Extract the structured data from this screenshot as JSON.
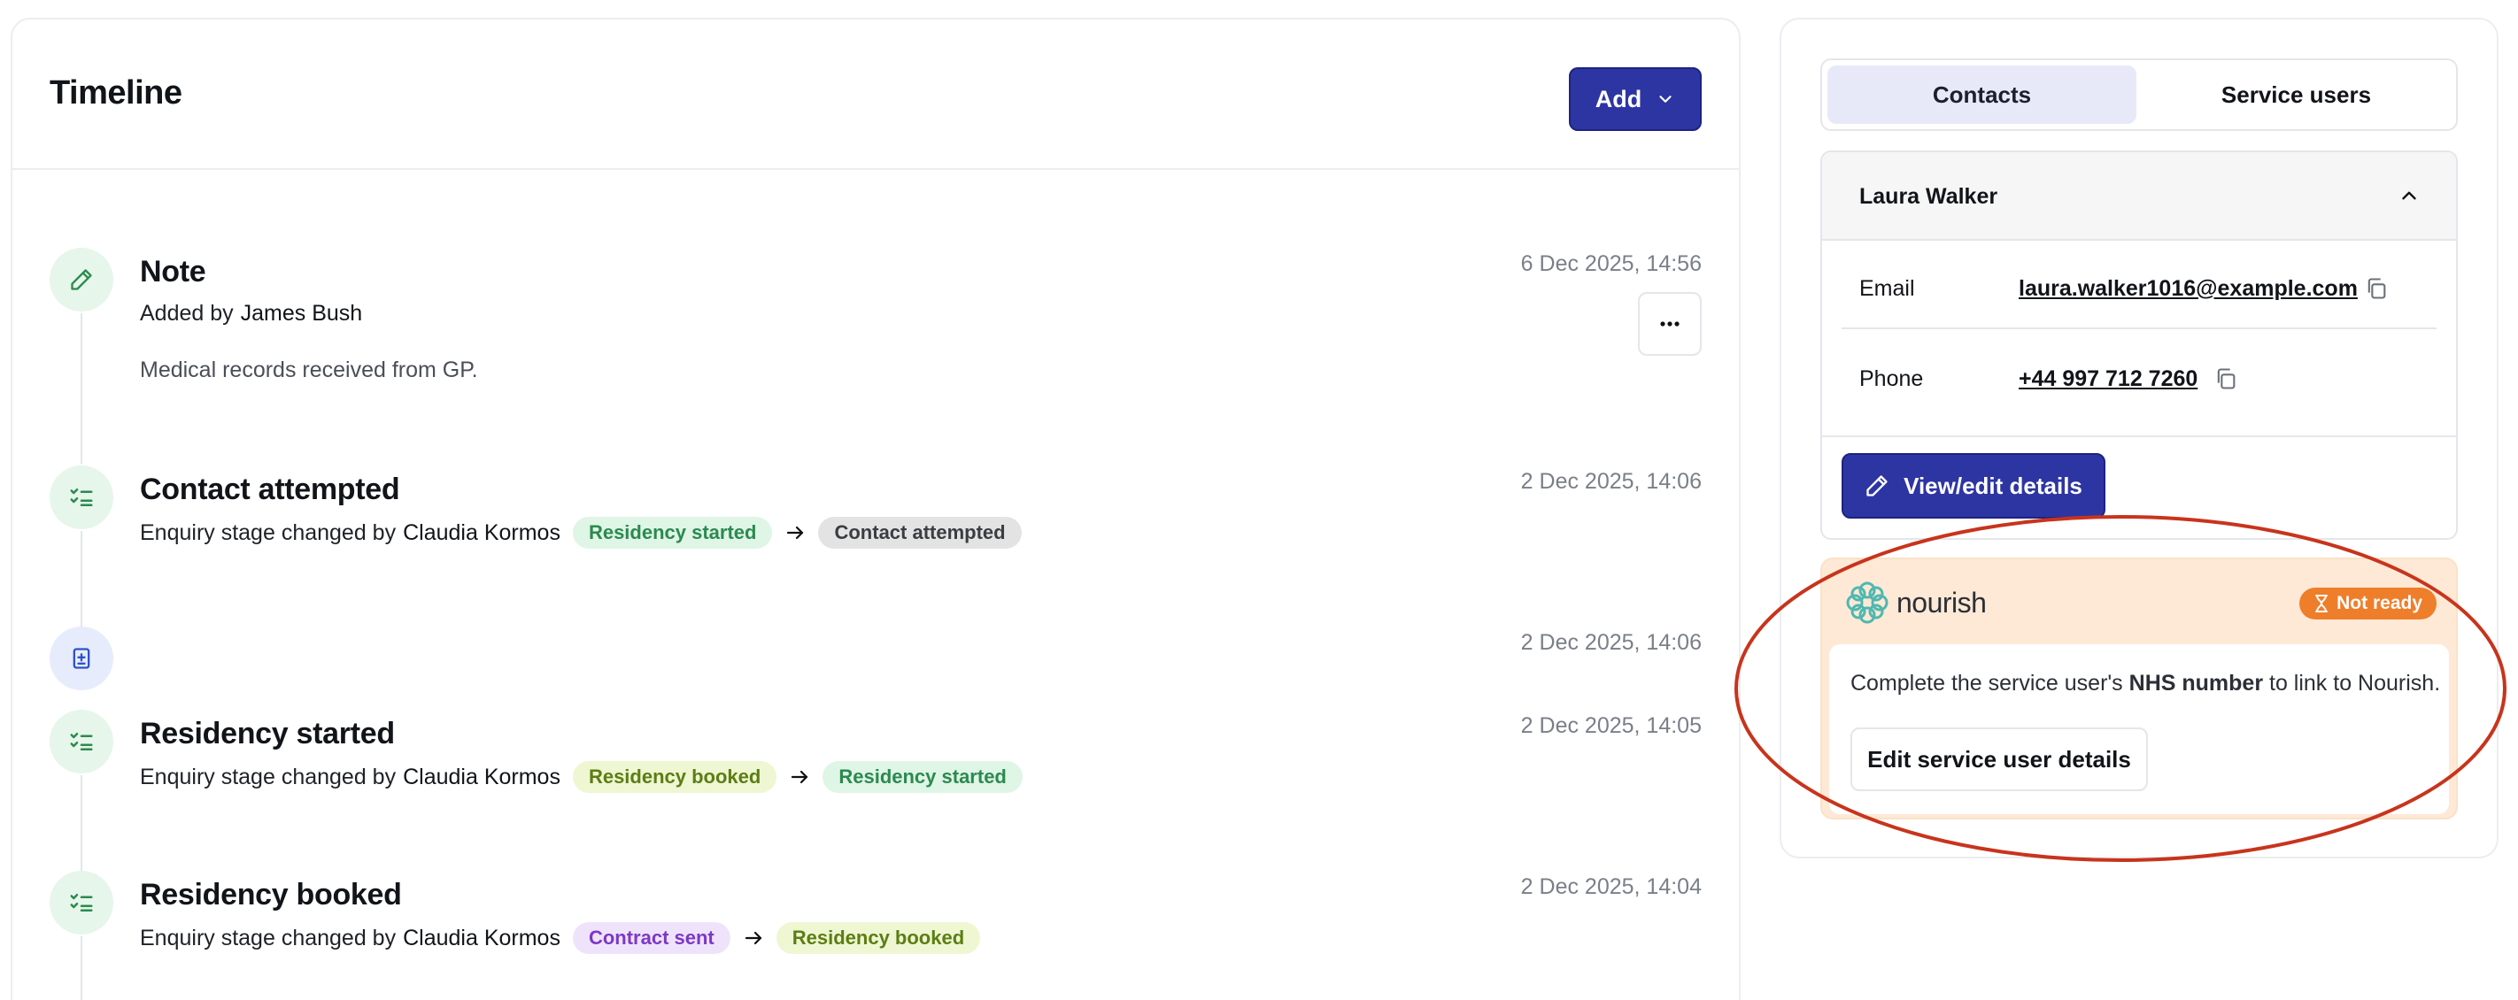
{
  "timeline": {
    "title": "Timeline",
    "add_label": "Add",
    "items": [
      {
        "title": "Note",
        "added_by_prefix": "Added by",
        "author": "James Bush",
        "body": "Medical records received from GP.",
        "date": "6 Dec 2025, 14:56"
      },
      {
        "title": "Contact attempted",
        "meta_prefix": "Enquiry stage changed by",
        "author": "Claudia Kormos",
        "from_stage": "Residency started",
        "to_stage": "Contact attempted",
        "date": "2 Dec 2025, 14:06"
      },
      {
        "title": "",
        "date": "2 Dec 2025, 14:06"
      },
      {
        "title": "Residency started",
        "meta_prefix": "Enquiry stage changed by",
        "author": "Claudia Kormos",
        "from_stage": "Residency booked",
        "to_stage": "Residency started",
        "date": "2 Dec 2025, 14:05"
      },
      {
        "title": "Residency booked",
        "meta_prefix": "Enquiry stage changed by",
        "author": "Claudia Kormos",
        "from_stage": "Contract sent",
        "to_stage": "Residency booked",
        "date": "2 Dec 2025, 14:04"
      }
    ]
  },
  "sidebar": {
    "tabs": [
      {
        "label": "Contacts",
        "active": true
      },
      {
        "label": "Service users",
        "active": false
      }
    ],
    "contact": {
      "name": "Laura Walker",
      "email_label": "Email",
      "email": "laura.walker1016@example.com",
      "phone_label": "Phone",
      "phone": "+44 997 712 7260",
      "view_edit_label": "View/edit details"
    },
    "nourish": {
      "brand": "nourish",
      "status": "Not ready",
      "message_prefix": "Complete the service user's",
      "message_bold": "NHS number",
      "message_suffix": "to link to Nourish.",
      "edit_button": "Edit service user details"
    }
  },
  "colors": {
    "primary": "#2d35a3",
    "annotation": "#c8341c",
    "status_orange": "#ef7e2a",
    "nourish_teal": "#4fb8b0"
  }
}
